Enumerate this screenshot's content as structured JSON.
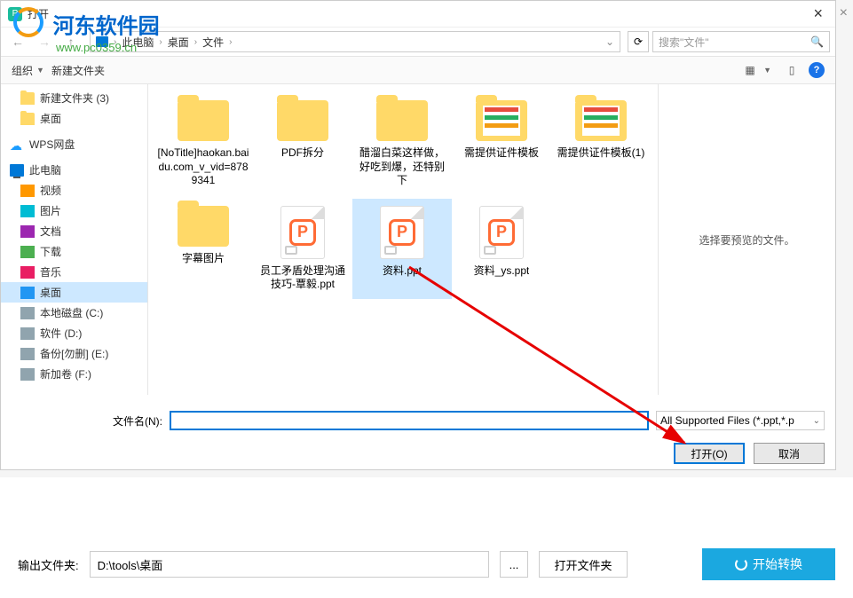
{
  "window": {
    "title": "打开",
    "close_label": "×"
  },
  "watermark": {
    "text": "河东软件园",
    "url": "www.pc0359.cn"
  },
  "breadcrumb": {
    "items": [
      "此电脑",
      "桌面",
      "文件"
    ],
    "sep": "›"
  },
  "search": {
    "placeholder": "搜索\"文件\""
  },
  "toolbar": {
    "organize": "组织",
    "newfolder": "新建文件夹"
  },
  "sidebar": {
    "items": [
      {
        "label": "新建文件夹 (3)",
        "icon": "folder",
        "indent": 1
      },
      {
        "label": "桌面",
        "icon": "folder",
        "indent": 1
      },
      {
        "label": "WPS网盘",
        "icon": "cloud",
        "indent": 0,
        "top": true
      },
      {
        "label": "此电脑",
        "icon": "pc",
        "indent": 0,
        "top": true
      },
      {
        "label": "视频",
        "icon": "video",
        "indent": 1
      },
      {
        "label": "图片",
        "icon": "pic",
        "indent": 1
      },
      {
        "label": "文档",
        "icon": "doc",
        "indent": 1
      },
      {
        "label": "下载",
        "icon": "down",
        "indent": 1
      },
      {
        "label": "音乐",
        "icon": "music",
        "indent": 1
      },
      {
        "label": "桌面",
        "icon": "desktop",
        "indent": 1,
        "selected": true
      },
      {
        "label": "本地磁盘 (C:)",
        "icon": "drive",
        "indent": 1
      },
      {
        "label": "软件 (D:)",
        "icon": "drive",
        "indent": 1
      },
      {
        "label": "备份[勿删] (E:)",
        "icon": "drive",
        "indent": 1
      },
      {
        "label": "新加卷 (F:)",
        "icon": "drive",
        "indent": 1
      }
    ]
  },
  "files": [
    {
      "name": "[NoTitle]haokan.baidu.com_v_vid=8789341",
      "type": "folder"
    },
    {
      "name": "PDF拆分",
      "type": "folder"
    },
    {
      "name": "醋溜白菜这样做，好吃到爆，还特别下",
      "type": "folder"
    },
    {
      "name": "需提供证件模板",
      "type": "folder-thumb"
    },
    {
      "name": "需提供证件模板(1)",
      "type": "folder-thumb"
    },
    {
      "name": "字幕图片",
      "type": "folder"
    },
    {
      "name": "员工矛盾处理沟通技巧-覃毅.ppt",
      "type": "ppt"
    },
    {
      "name": "资料.ppt",
      "type": "ppt",
      "selected": true
    },
    {
      "name": "资料_ys.ppt",
      "type": "ppt"
    }
  ],
  "preview": {
    "empty_text": "选择要预览的文件。"
  },
  "filename": {
    "label": "文件名(N):",
    "value": "",
    "filter": "All Supported Files (*.ppt,*.p"
  },
  "actions": {
    "open": "打开(O)",
    "cancel": "取消"
  },
  "bottom": {
    "output_label": "输出文件夹:",
    "output_path": "D:\\tools\\桌面",
    "browse": "...",
    "open_folder": "打开文件夹",
    "start": "开始转换"
  }
}
